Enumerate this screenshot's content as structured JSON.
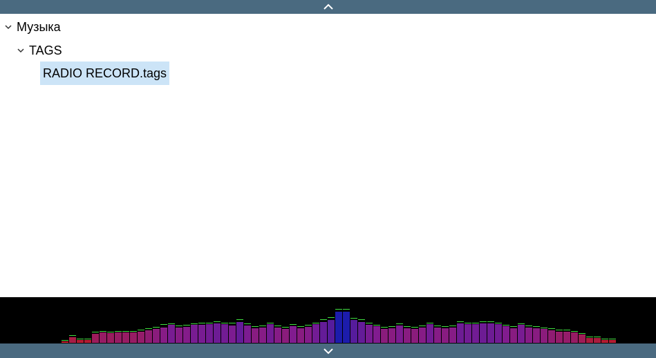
{
  "tree": {
    "root": {
      "label": "Музыка",
      "expanded": true
    },
    "folder": {
      "label": "TAGS",
      "expanded": true
    },
    "file": {
      "label": "RADIO RECORD.tags",
      "selected": true
    }
  },
  "icons": {
    "scroll_up": "chevron-up-icon",
    "scroll_down": "chevron-down-icon",
    "expand": "chevron-down-icon"
  },
  "colors": {
    "scrollbar": "#4a6a80",
    "selection": "#cce4f7",
    "spectrum_background": "#000000",
    "spectrum_low": "#d02020",
    "spectrum_mid": "#9020a0",
    "spectrum_high": "#2020c0",
    "spectrum_peak": "#40e040"
  },
  "spectrum": {
    "levels": [
      0.04,
      0.14,
      0.07,
      0.07,
      0.22,
      0.25,
      0.23,
      0.25,
      0.25,
      0.25,
      0.27,
      0.3,
      0.33,
      0.37,
      0.43,
      0.37,
      0.38,
      0.43,
      0.43,
      0.45,
      0.47,
      0.45,
      0.42,
      0.5,
      0.42,
      0.35,
      0.37,
      0.45,
      0.37,
      0.33,
      0.4,
      0.35,
      0.38,
      0.45,
      0.5,
      0.55,
      0.75,
      0.75,
      0.55,
      0.5,
      0.43,
      0.4,
      0.33,
      0.35,
      0.42,
      0.35,
      0.33,
      0.37,
      0.45,
      0.37,
      0.35,
      0.37,
      0.47,
      0.45,
      0.45,
      0.47,
      0.47,
      0.45,
      0.4,
      0.35,
      0.43,
      0.37,
      0.35,
      0.33,
      0.3,
      0.27,
      0.27,
      0.25,
      0.2,
      0.12,
      0.12,
      0.07,
      0.07
    ],
    "peaks": [
      0.05,
      0.17,
      0.08,
      0.08,
      0.25,
      0.27,
      0.25,
      0.27,
      0.27,
      0.27,
      0.3,
      0.33,
      0.37,
      0.43,
      0.45,
      0.4,
      0.42,
      0.45,
      0.47,
      0.47,
      0.5,
      0.47,
      0.47,
      0.55,
      0.45,
      0.38,
      0.4,
      0.47,
      0.4,
      0.37,
      0.43,
      0.38,
      0.42,
      0.47,
      0.55,
      0.6,
      0.8,
      0.8,
      0.58,
      0.55,
      0.47,
      0.42,
      0.37,
      0.38,
      0.45,
      0.38,
      0.37,
      0.4,
      0.47,
      0.4,
      0.38,
      0.4,
      0.5,
      0.47,
      0.47,
      0.5,
      0.5,
      0.47,
      0.42,
      0.38,
      0.45,
      0.4,
      0.38,
      0.35,
      0.33,
      0.3,
      0.3,
      0.27,
      0.22,
      0.13,
      0.13,
      0.08,
      0.08
    ]
  }
}
